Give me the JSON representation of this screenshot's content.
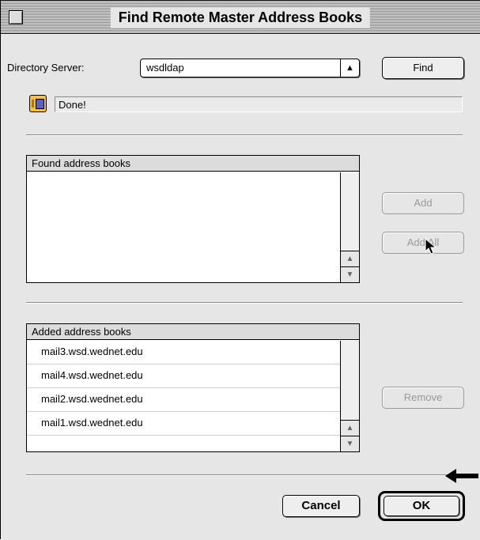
{
  "window": {
    "title": "Find Remote Master Address Books"
  },
  "directory": {
    "label": "Directory Server:",
    "value": "wsdldap",
    "find_label": "Find"
  },
  "status": {
    "text": "Done!"
  },
  "found": {
    "header": "Found address books",
    "items": [],
    "add_label": "Add",
    "add_all_label": "Add All"
  },
  "added": {
    "header": "Added address books",
    "items": [
      "mail3.wsd.wednet.edu",
      "mail4.wsd.wednet.edu",
      "mail2.wsd.wednet.edu",
      "mail1.wsd.wednet.edu"
    ],
    "remove_label": "Remove"
  },
  "footer": {
    "cancel_label": "Cancel",
    "ok_label": "OK"
  }
}
